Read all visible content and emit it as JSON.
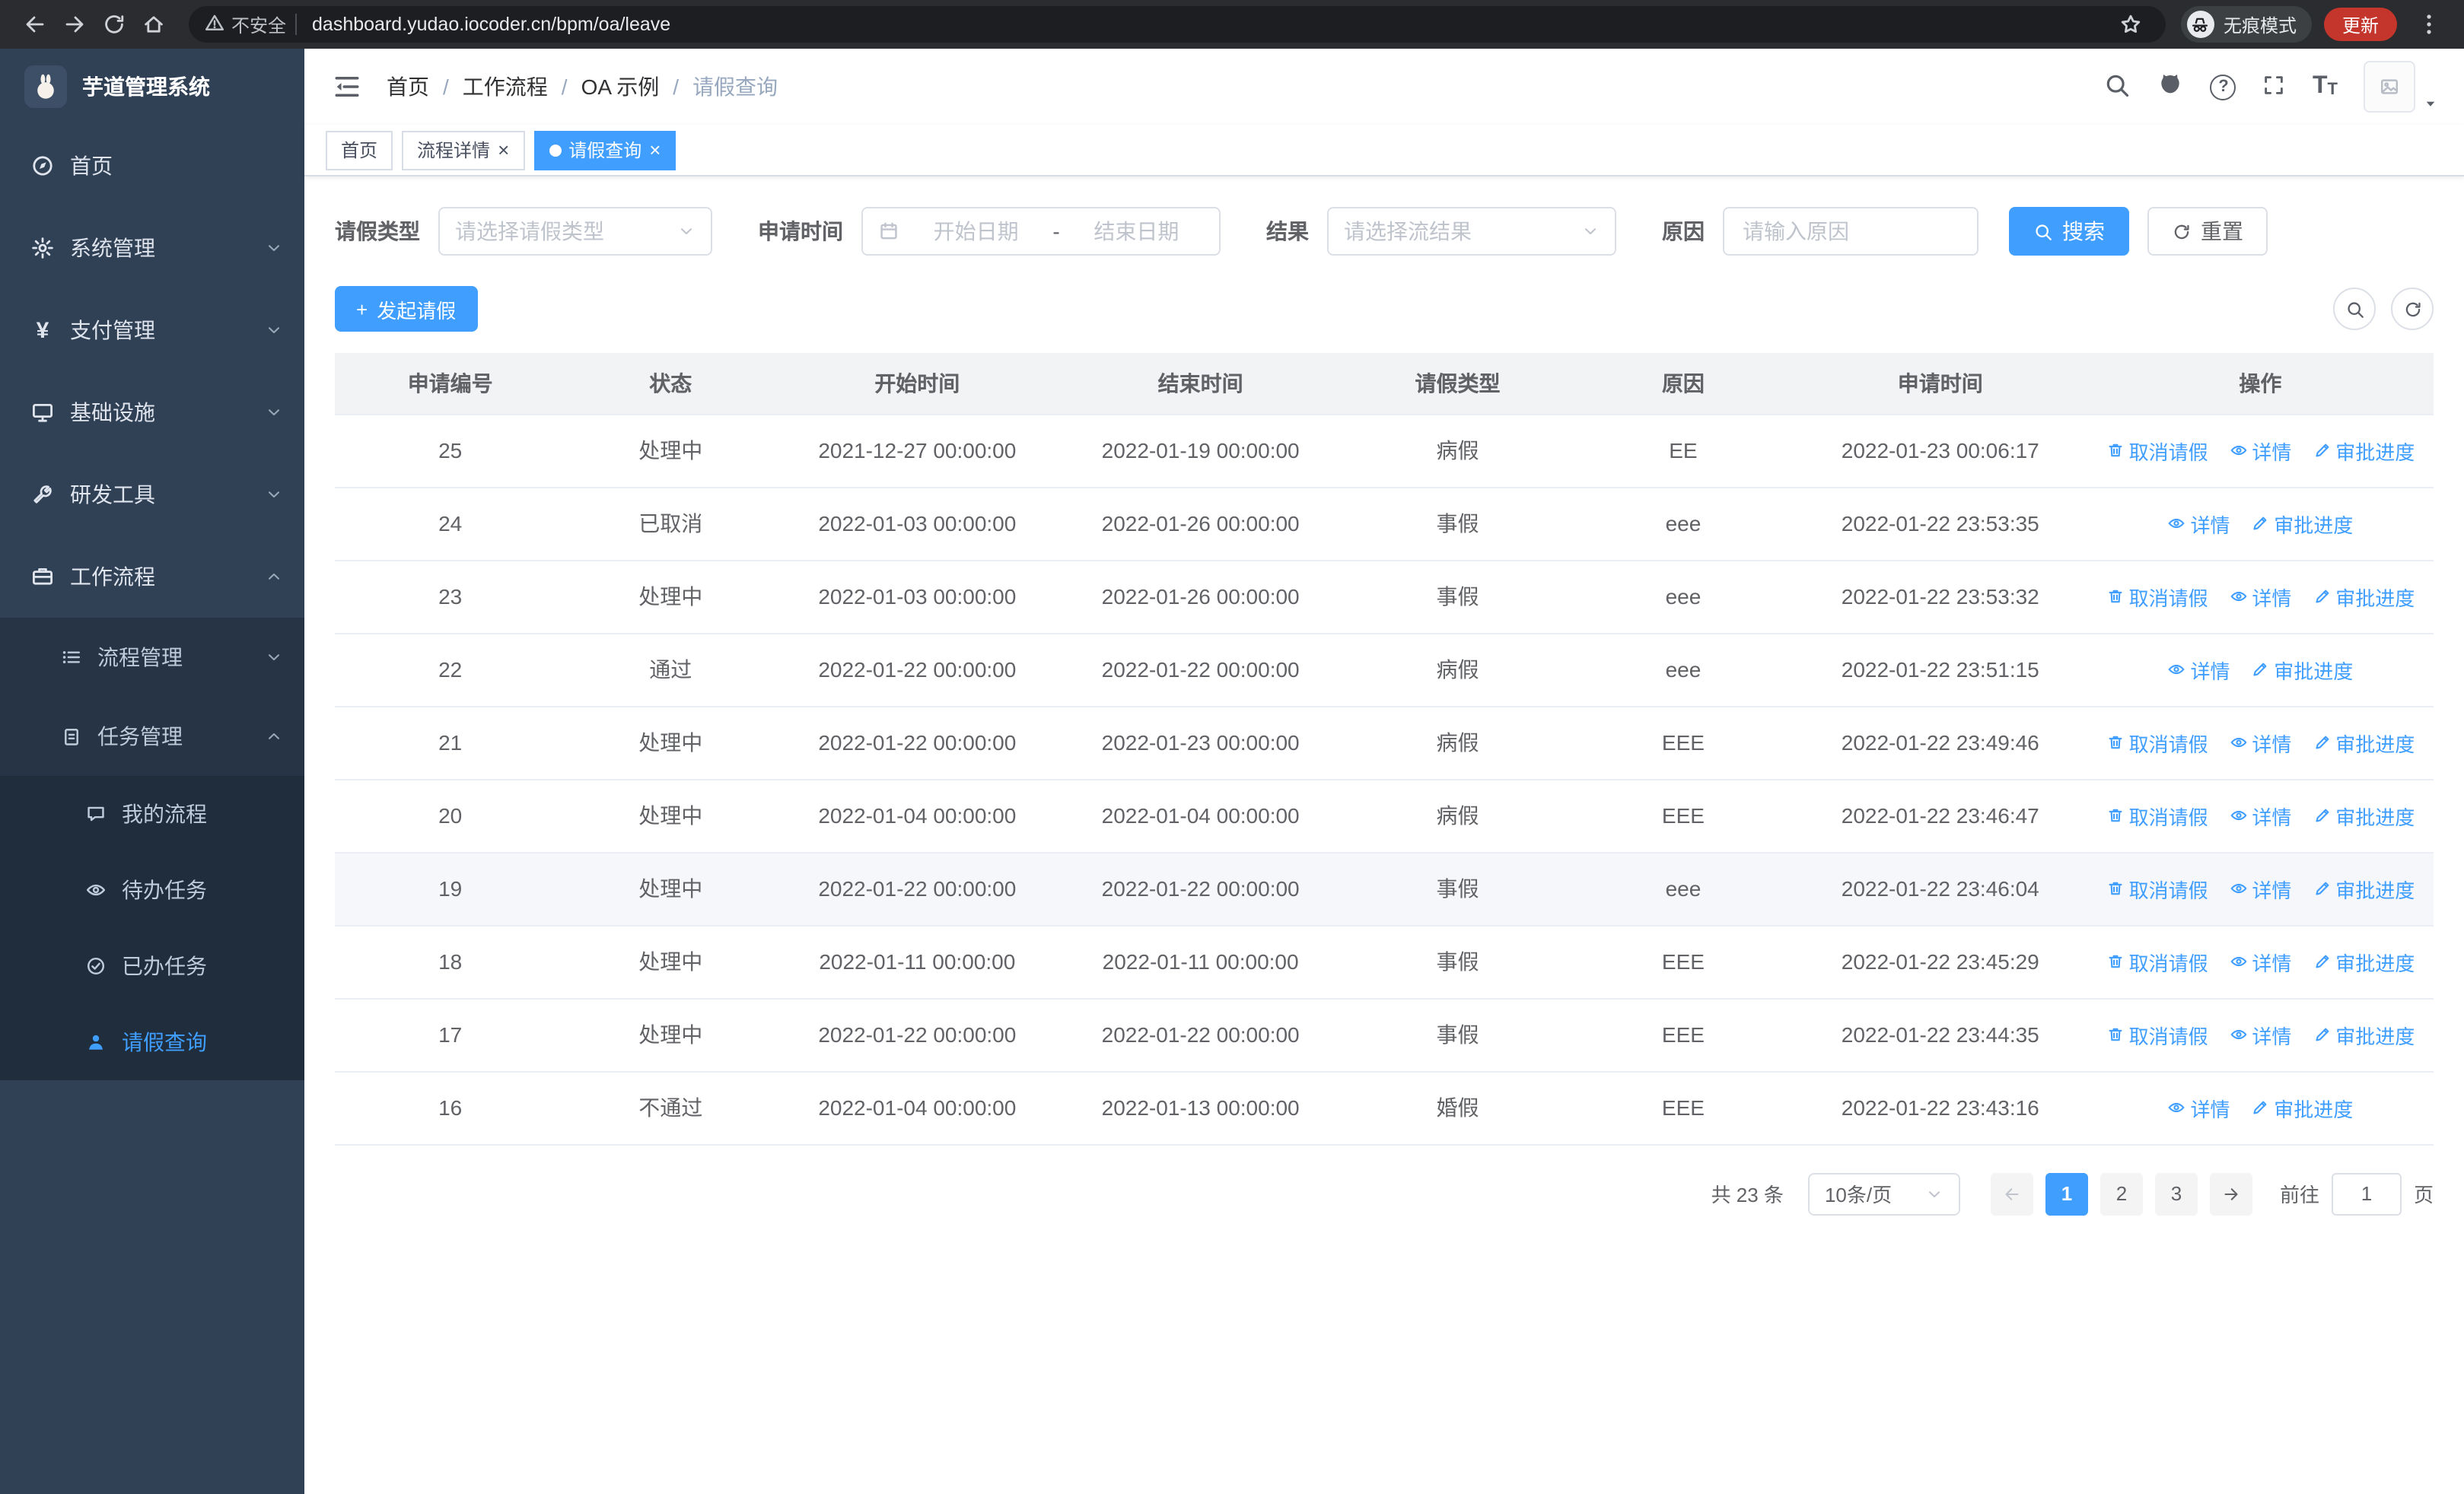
{
  "browser": {
    "security_label": "不安全",
    "url": "dashboard.yudao.iocoder.cn/bpm/oa/leave",
    "incognito_label": "无痕模式",
    "update_label": "更新"
  },
  "icons": {
    "close": "×",
    "plus": "+",
    "question": "?",
    "yen": "¥",
    "font_size": "T",
    "kebab_note": "three-dot-menu"
  },
  "colors": {
    "primary": "#409eff",
    "sidebar_bg": "#304156",
    "sidebar_submenu_bg": "#1f2d3d",
    "update_pill": "#c4352b",
    "table_header_bg": "#f2f3f5"
  },
  "sidebar": {
    "title": "芋道管理系统",
    "menu": [
      {
        "label": "首页"
      },
      {
        "label": "系统管理"
      },
      {
        "label": "支付管理"
      },
      {
        "label": "基础设施"
      },
      {
        "label": "研发工具"
      },
      {
        "label": "工作流程"
      }
    ],
    "submenu": {
      "process_mgmt": "流程管理",
      "task_mgmt": "任务管理",
      "leaves": [
        {
          "label": "我的流程"
        },
        {
          "label": "待办任务"
        },
        {
          "label": "已办任务"
        },
        {
          "label": "请假查询",
          "active": true
        }
      ]
    }
  },
  "header": {
    "breadcrumb": [
      "首页",
      "工作流程",
      "OA 示例",
      "请假查询"
    ],
    "separator": "/"
  },
  "tabs": [
    {
      "label": "首页"
    },
    {
      "label": "流程详情",
      "closable": true
    },
    {
      "label": "请假查询",
      "closable": true,
      "active": true
    }
  ],
  "filters": {
    "leave_type_label": "请假类型",
    "leave_type_placeholder": "请选择请假类型",
    "apply_time_label": "申请时间",
    "date_start_placeholder": "开始日期",
    "date_separator": "-",
    "date_end_placeholder": "结束日期",
    "result_label": "结果",
    "result_placeholder": "请选择流结果",
    "reason_label": "原因",
    "reason_placeholder": "请输入原因",
    "search_button": "搜索",
    "reset_button": "重置"
  },
  "toolbar": {
    "create_button": "发起请假"
  },
  "table": {
    "columns": [
      "申请编号",
      "状态",
      "开始时间",
      "结束时间",
      "请假类型",
      "原因",
      "申请时间",
      "操作"
    ],
    "action_labels": {
      "cancel": "取消请假",
      "detail": "详情",
      "progress": "审批进度"
    },
    "rows": [
      {
        "id": "25",
        "status": "处理中",
        "start": "2021-12-27 00:00:00",
        "end": "2022-01-19 00:00:00",
        "type": "病假",
        "reason": "EE",
        "applied": "2022-01-23 00:06:17",
        "actions": [
          "cancel",
          "detail",
          "progress"
        ]
      },
      {
        "id": "24",
        "status": "已取消",
        "start": "2022-01-03 00:00:00",
        "end": "2022-01-26 00:00:00",
        "type": "事假",
        "reason": "eee",
        "applied": "2022-01-22 23:53:35",
        "actions": [
          "detail",
          "progress"
        ]
      },
      {
        "id": "23",
        "status": "处理中",
        "start": "2022-01-03 00:00:00",
        "end": "2022-01-26 00:00:00",
        "type": "事假",
        "reason": "eee",
        "applied": "2022-01-22 23:53:32",
        "actions": [
          "cancel",
          "detail",
          "progress"
        ]
      },
      {
        "id": "22",
        "status": "通过",
        "start": "2022-01-22 00:00:00",
        "end": "2022-01-22 00:00:00",
        "type": "病假",
        "reason": "eee",
        "applied": "2022-01-22 23:51:15",
        "actions": [
          "detail",
          "progress"
        ]
      },
      {
        "id": "21",
        "status": "处理中",
        "start": "2022-01-22 00:00:00",
        "end": "2022-01-23 00:00:00",
        "type": "病假",
        "reason": "EEE",
        "applied": "2022-01-22 23:49:46",
        "actions": [
          "cancel",
          "detail",
          "progress"
        ]
      },
      {
        "id": "20",
        "status": "处理中",
        "start": "2022-01-04 00:00:00",
        "end": "2022-01-04 00:00:00",
        "type": "病假",
        "reason": "EEE",
        "applied": "2022-01-22 23:46:47",
        "actions": [
          "cancel",
          "detail",
          "progress"
        ]
      },
      {
        "id": "19",
        "status": "处理中",
        "start": "2022-01-22 00:00:00",
        "end": "2022-01-22 00:00:00",
        "type": "事假",
        "reason": "eee",
        "applied": "2022-01-22 23:46:04",
        "actions": [
          "cancel",
          "detail",
          "progress"
        ]
      },
      {
        "id": "18",
        "status": "处理中",
        "start": "2022-01-11 00:00:00",
        "end": "2022-01-11 00:00:00",
        "type": "事假",
        "reason": "EEE",
        "applied": "2022-01-22 23:45:29",
        "actions": [
          "cancel",
          "detail",
          "progress"
        ]
      },
      {
        "id": "17",
        "status": "处理中",
        "start": "2022-01-22 00:00:00",
        "end": "2022-01-22 00:00:00",
        "type": "事假",
        "reason": "EEE",
        "applied": "2022-01-22 23:44:35",
        "actions": [
          "cancel",
          "detail",
          "progress"
        ]
      },
      {
        "id": "16",
        "status": "不通过",
        "start": "2022-01-04 00:00:00",
        "end": "2022-01-13 00:00:00",
        "type": "婚假",
        "reason": "EEE",
        "applied": "2022-01-22 23:43:16",
        "actions": [
          "detail",
          "progress"
        ]
      }
    ]
  },
  "pagination": {
    "total": "共 23 条",
    "page_size": "10条/页",
    "pages": [
      "1",
      "2",
      "3"
    ],
    "current": "1",
    "goto_label": "前往",
    "goto_value": "1",
    "goto_suffix": "页"
  }
}
